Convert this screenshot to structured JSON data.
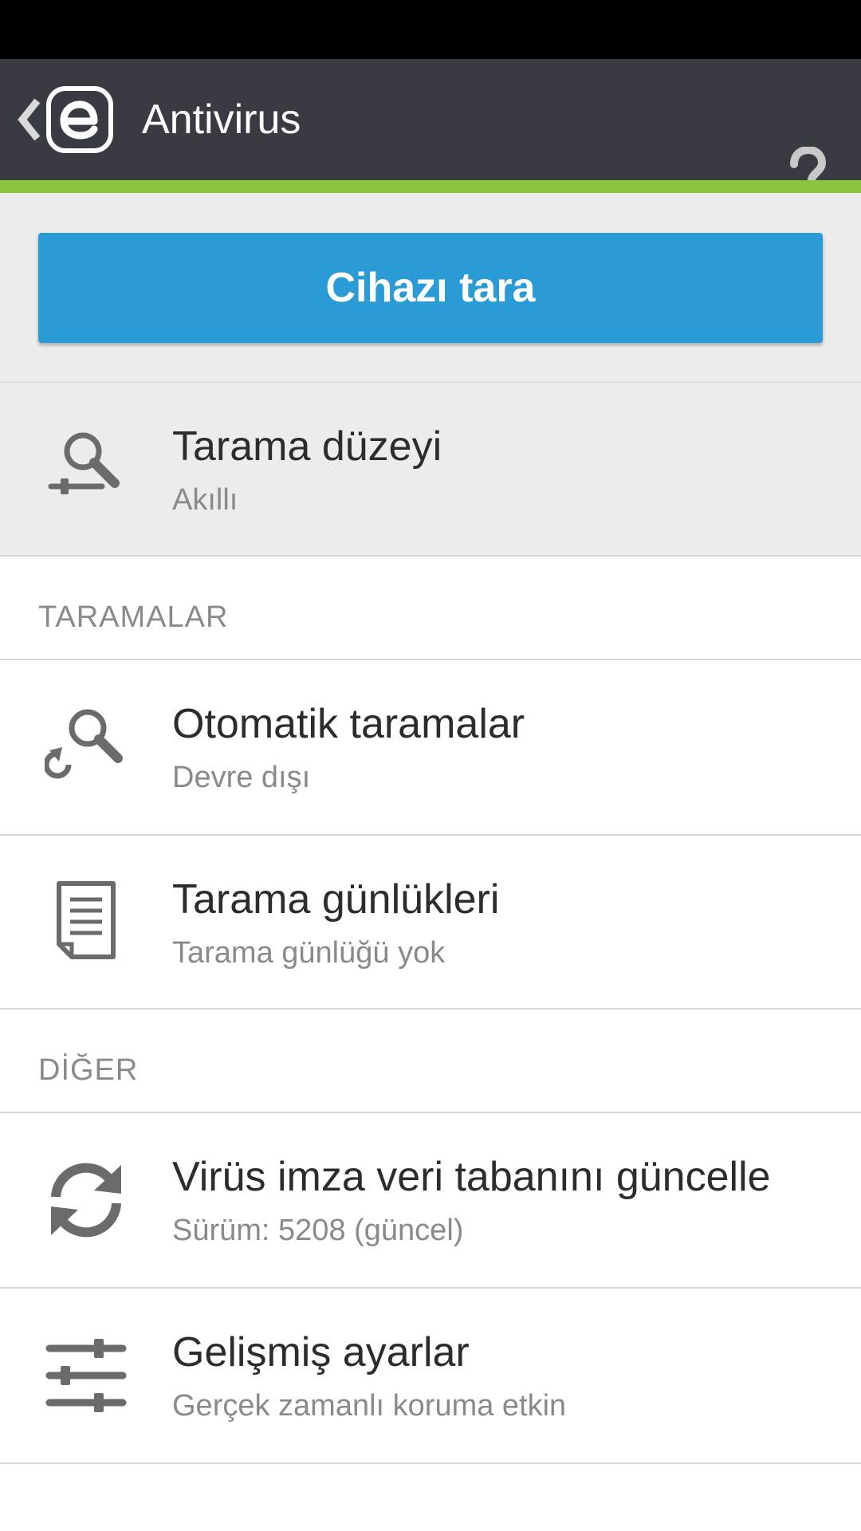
{
  "app_bar": {
    "title": "Antivirus",
    "help_symbol": "?",
    "back_icon": "chevron-left-icon",
    "logo_icon": "eset-logo-icon",
    "help_icon": "help-icon",
    "background": "#383c42",
    "accent": "#8cc43f"
  },
  "scan_button": {
    "label": "Cihazı tara",
    "color": "#2a9bd5"
  },
  "scan_level": {
    "title": "Tarama düzeyi",
    "value": "Akıllı",
    "icon": "scan-level-icon"
  },
  "sections": {
    "scans": {
      "header": "TARAMALAR",
      "items": [
        {
          "title": "Otomatik taramalar",
          "subtitle": "Devre dışı",
          "icon": "scheduled-scan-icon"
        },
        {
          "title": "Tarama günlükleri",
          "subtitle": "Tarama günlüğü yok",
          "icon": "document-icon"
        }
      ]
    },
    "other": {
      "header": "DİĞER",
      "items": [
        {
          "title": "Virüs imza veri tabanını güncelle",
          "subtitle": "Sürüm: 5208 (güncel)",
          "icon": "refresh-icon"
        },
        {
          "title": "Gelişmiş ayarlar",
          "subtitle": "Gerçek zamanlı koruma etkin",
          "icon": "sliders-icon"
        }
      ]
    }
  }
}
